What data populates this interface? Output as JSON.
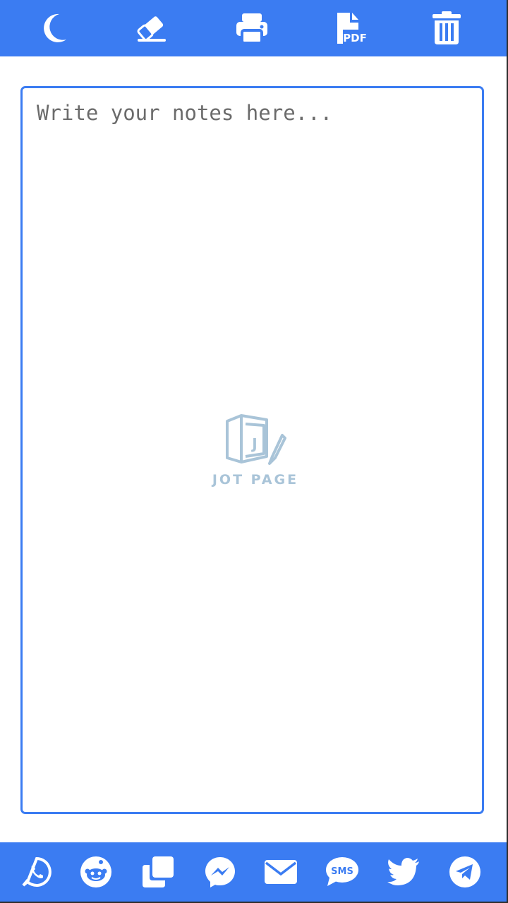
{
  "toolbar": {
    "items": [
      {
        "icon": "moon-icon",
        "label": "Dark mode"
      },
      {
        "icon": "eraser-icon",
        "label": "Clear"
      },
      {
        "icon": "print-icon",
        "label": "Print"
      },
      {
        "icon": "pdf-file-icon",
        "label": "PDF",
        "badge": "PDF"
      },
      {
        "icon": "trash-icon",
        "label": "Delete"
      }
    ]
  },
  "editor": {
    "placeholder": "Write your notes here...",
    "value": ""
  },
  "watermark": {
    "logo_letter": "J",
    "brand": "JOT PAGE"
  },
  "share": {
    "items": [
      {
        "icon": "whatsapp-icon"
      },
      {
        "icon": "reddit-icon"
      },
      {
        "icon": "copy-icon"
      },
      {
        "icon": "messenger-icon"
      },
      {
        "icon": "email-icon"
      },
      {
        "icon": "sms-icon",
        "badge": "SMS"
      },
      {
        "icon": "twitter-icon"
      },
      {
        "icon": "telegram-icon"
      }
    ]
  },
  "colors": {
    "accent": "#3b7cf2",
    "icon": "#ffffff",
    "watermark": "#a9c4d8"
  }
}
